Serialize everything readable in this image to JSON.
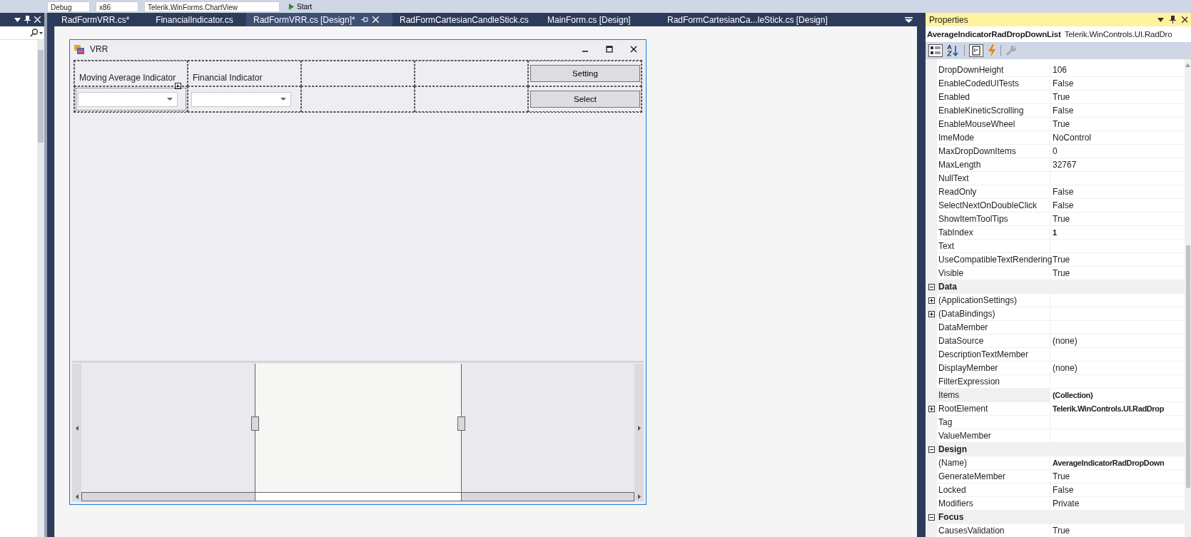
{
  "toolbar": {
    "configuration": "Debug",
    "platform": "x86",
    "startup_project": "Telerik.WinForms.ChartView",
    "start_button": "Start"
  },
  "tabs": [
    {
      "label": "RadFormVRR.cs*",
      "selected": false
    },
    {
      "label": "FinancialIndicator.cs",
      "selected": false
    },
    {
      "label": "RadFormVRR.cs [Design]*",
      "selected": true
    },
    {
      "label": "RadFormCartesianCandleStick.cs",
      "selected": false
    },
    {
      "label": "MainForm.cs [Design]",
      "selected": false
    },
    {
      "label": "RadFormCartesianCa...leStick.cs [Design]",
      "selected": false
    }
  ],
  "form": {
    "title": "VRR",
    "labels": [
      "Moving Average Indicator",
      "Financial Indicator"
    ],
    "buttons": [
      "Setting",
      "Select"
    ]
  },
  "properties": {
    "title": "Properties",
    "object_name": "AverageIndicatorRadDropDownList",
    "object_type": "Telerik.WinControls.UI.RadDro",
    "groups": [
      {
        "properties": [
          {
            "name": "DropDownHeight",
            "value": "106",
            "bold": false,
            "expandable": false,
            "selected": false
          },
          {
            "name": "EnableCodedUITests",
            "value": "False",
            "bold": false,
            "expandable": false,
            "selected": false
          },
          {
            "name": "Enabled",
            "value": "True",
            "bold": false,
            "expandable": false,
            "selected": false
          },
          {
            "name": "EnableKineticScrolling",
            "value": "False",
            "bold": false,
            "expandable": false,
            "selected": false
          },
          {
            "name": "EnableMouseWheel",
            "value": "True",
            "bold": false,
            "expandable": false,
            "selected": false
          },
          {
            "name": "ImeMode",
            "value": "NoControl",
            "bold": false,
            "expandable": false,
            "selected": false
          },
          {
            "name": "MaxDropDownItems",
            "value": "0",
            "bold": false,
            "expandable": false,
            "selected": false
          },
          {
            "name": "MaxLength",
            "value": "32767",
            "bold": false,
            "expandable": false,
            "selected": false
          },
          {
            "name": "NullText",
            "expandable": false,
            "selected": false
          },
          {
            "name": "ReadOnly",
            "value": "False",
            "bold": false,
            "expandable": false,
            "selected": false
          },
          {
            "name": "SelectNextOnDoubleClick",
            "value": "False",
            "bold": false,
            "expandable": false,
            "selected": false
          },
          {
            "name": "ShowItemToolTips",
            "value": "True",
            "bold": false,
            "expandable": false,
            "selected": false
          },
          {
            "name": "TabIndex",
            "value": "1",
            "bold": true,
            "expandable": false,
            "selected": false
          },
          {
            "name": "Text",
            "expandable": false,
            "selected": false
          },
          {
            "name": "UseCompatibleTextRendering",
            "value": "True",
            "bold": false,
            "expandable": false,
            "selected": false
          },
          {
            "name": "Visible",
            "value": "True",
            "bold": false,
            "expandable": false,
            "selected": false
          }
        ]
      },
      {
        "name": "Data",
        "expanded": true,
        "properties": [
          {
            "name": "(ApplicationSettings)",
            "expandable": true,
            "selected": false
          },
          {
            "name": "(DataBindings)",
            "expandable": true,
            "selected": false
          },
          {
            "name": "DataMember",
            "expandable": false,
            "selected": false
          },
          {
            "name": "DataSource",
            "value": "(none)",
            "bold": false,
            "expandable": false,
            "selected": false
          },
          {
            "name": "DescriptionTextMember",
            "expandable": false,
            "selected": false
          },
          {
            "name": "DisplayMember",
            "value": "(none)",
            "bold": false,
            "expandable": false,
            "selected": false
          },
          {
            "name": "FilterExpression",
            "expandable": false,
            "selected": false
          },
          {
            "name": "Items",
            "value": "(Collection)",
            "bold": true,
            "expandable": false,
            "selected": true
          },
          {
            "name": "RootElement",
            "value": "Telerik.WinControls.UI.RadDrop",
            "bold": true,
            "expandable": true,
            "selected": false
          },
          {
            "name": "Tag",
            "expandable": false,
            "selected": false
          },
          {
            "name": "ValueMember",
            "expandable": false,
            "selected": false
          }
        ]
      },
      {
        "name": "Design",
        "expanded": true,
        "properties": [
          {
            "name": "(Name)",
            "value": "AverageIndicatorRadDropDown",
            "bold": true,
            "expandable": false,
            "selected": false
          },
          {
            "name": "GenerateMember",
            "value": "True",
            "bold": false,
            "expandable": false,
            "selected": false
          },
          {
            "name": "Locked",
            "value": "False",
            "bold": false,
            "expandable": false,
            "selected": false
          },
          {
            "name": "Modifiers",
            "value": "Private",
            "bold": false,
            "expandable": false,
            "selected": false
          }
        ]
      },
      {
        "name": "Focus",
        "expanded": true,
        "properties": [
          {
            "name": "CausesValidation",
            "value": "True",
            "bold": false,
            "expandable": false,
            "selected": false
          }
        ]
      }
    ]
  }
}
